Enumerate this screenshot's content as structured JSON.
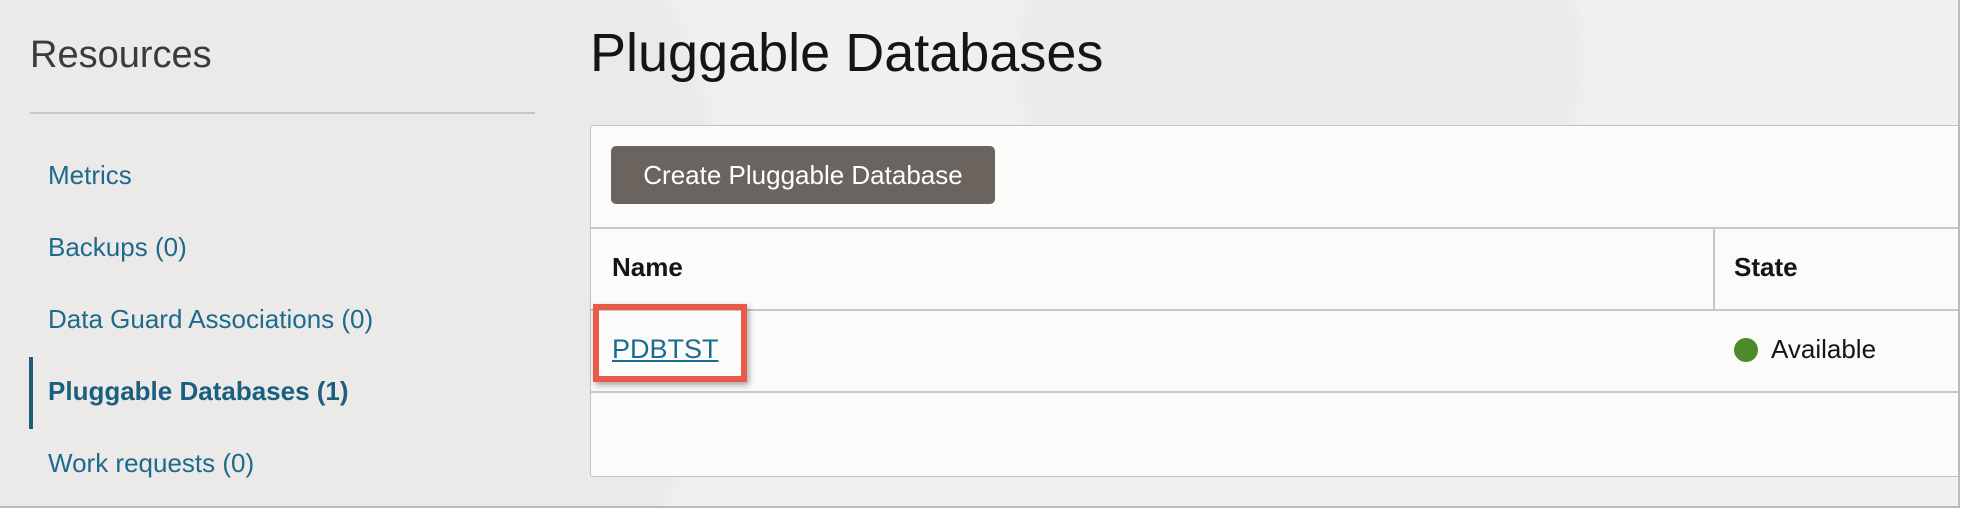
{
  "sidebar": {
    "title": "Resources",
    "items": [
      {
        "label": "Metrics",
        "active": false
      },
      {
        "label": "Backups (0)",
        "active": false
      },
      {
        "label": "Data Guard Associations (0)",
        "active": false
      },
      {
        "label": "Pluggable Databases (1)",
        "active": true
      },
      {
        "label": "Work requests (0)",
        "active": false
      }
    ]
  },
  "main": {
    "title": "Pluggable Databases",
    "create_button_label": "Create Pluggable Database",
    "table": {
      "columns": [
        "Name",
        "State"
      ],
      "rows": [
        {
          "name": "PDBTST",
          "state": "Available",
          "state_color": "#4e8a2a"
        }
      ]
    }
  },
  "colors": {
    "link": "#1d6a8d",
    "button_bg": "#6a635e",
    "highlight": "#e85a4a"
  }
}
